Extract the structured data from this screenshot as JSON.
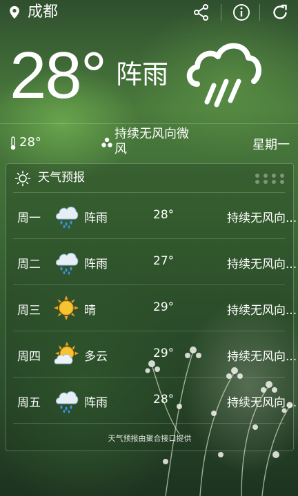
{
  "header": {
    "city": "成都",
    "icons": [
      "location-pin-icon",
      "share-icon",
      "info-icon",
      "refresh-icon"
    ]
  },
  "current": {
    "temperature": "28°",
    "condition": "阵雨",
    "icon": "cloud-rain-icon",
    "small_temp": "28°",
    "wind": "持续无风向微风",
    "weekday": "星期一"
  },
  "forecast": {
    "title": "天气预报",
    "days": [
      {
        "day": "周一",
        "icon": "rain-cloud-icon",
        "condition": "阵雨",
        "temp": "28°",
        "wind": "持续无风向..."
      },
      {
        "day": "周二",
        "icon": "rain-cloud-icon",
        "condition": "阵雨",
        "temp": "27°",
        "wind": "持续无风向..."
      },
      {
        "day": "周三",
        "icon": "sun-icon",
        "condition": "晴",
        "temp": "29°",
        "wind": "持续无风向..."
      },
      {
        "day": "周四",
        "icon": "partly-cloudy-icon",
        "condition": "多云",
        "temp": "29°",
        "wind": "持续无风向..."
      },
      {
        "day": "周五",
        "icon": "rain-cloud-icon",
        "condition": "阵雨",
        "temp": "28°",
        "wind": "持续无风向..."
      }
    ],
    "credit": "天气预报由聚合接口提供"
  }
}
